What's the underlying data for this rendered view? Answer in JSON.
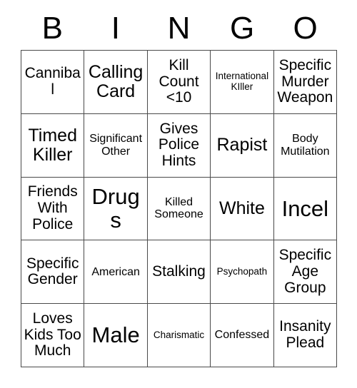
{
  "card": {
    "title": "Bingo Card",
    "header_letters": [
      "B",
      "I",
      "N",
      "G",
      "O"
    ],
    "rows": [
      [
        {
          "label": "Cannibal",
          "size": "md"
        },
        {
          "label": "Calling Card",
          "size": "lg"
        },
        {
          "label": "Kill Count <10",
          "size": "md"
        },
        {
          "label": "International KIller",
          "size": "xs"
        },
        {
          "label": "Specific Murder Weapon",
          "size": "md"
        }
      ],
      [
        {
          "label": "Timed Killer",
          "size": "lg"
        },
        {
          "label": "Significant Other",
          "size": "sm"
        },
        {
          "label": "Gives Police Hints",
          "size": "md"
        },
        {
          "label": "Rapist",
          "size": "lg"
        },
        {
          "label": "Body Mutilation",
          "size": "sm"
        }
      ],
      [
        {
          "label": "Friends With Police",
          "size": "md"
        },
        {
          "label": "Drugs",
          "size": "xl"
        },
        {
          "label": "Killed Someone",
          "size": "sm"
        },
        {
          "label": "White",
          "size": "lg"
        },
        {
          "label": "Incel",
          "size": "xl"
        }
      ],
      [
        {
          "label": "Specific Gender",
          "size": "md"
        },
        {
          "label": "American",
          "size": "sm"
        },
        {
          "label": "Stalking",
          "size": "md"
        },
        {
          "label": "Psychopath",
          "size": "xs"
        },
        {
          "label": "Specific Age Group",
          "size": "md"
        }
      ],
      [
        {
          "label": "Loves Kids Too Much",
          "size": "md"
        },
        {
          "label": "Male",
          "size": "xl"
        },
        {
          "label": "Charismatic",
          "size": "xs"
        },
        {
          "label": "Confessed",
          "size": "sm"
        },
        {
          "label": "Insanity Plead",
          "size": "md"
        }
      ]
    ],
    "colors": {
      "background": "#ffffff",
      "border": "#4a4a4a",
      "text": "#000000"
    }
  }
}
